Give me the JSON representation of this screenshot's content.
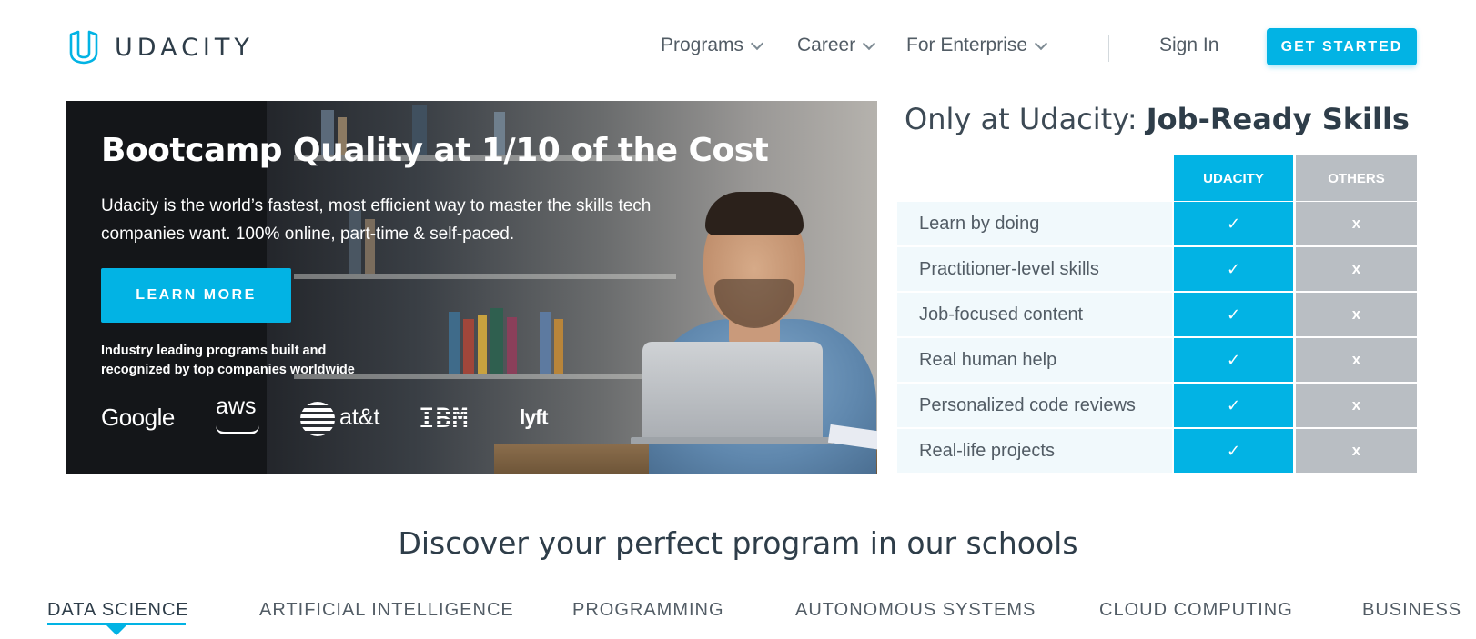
{
  "header": {
    "logo_text": "UDACITY",
    "nav": [
      {
        "label": "Programs",
        "icon": "chevron-down-icon"
      },
      {
        "label": "Career",
        "icon": "chevron-down-icon"
      },
      {
        "label": "For Enterprise",
        "icon": "chevron-down-icon"
      }
    ],
    "sign_in": "Sign In",
    "cta": "GET STARTED"
  },
  "hero": {
    "title": "Bootcamp Quality at 1/10 of the Cost",
    "subtitle": "Udacity is the world’s fastest, most efficient way to master the skills tech companies want. 100% online, part-time & self-paced.",
    "button": "LEARN MORE",
    "industry_text": "Industry leading programs built and recognized by top companies worldwide",
    "partners": [
      "Google",
      "aws",
      "at&t",
      "IBM",
      "lyft"
    ]
  },
  "comparison": {
    "title_light": "Only at Udacity: ",
    "title_bold": "Job-Ready Skills",
    "col_udacity": "UDACITY",
    "col_others": "OTHERS",
    "check_glyph": "✓",
    "x_glyph": "x",
    "rows": [
      {
        "label": "Learn by doing"
      },
      {
        "label": "Practitioner-level skills"
      },
      {
        "label": "Job-focused content"
      },
      {
        "label": "Real human help"
      },
      {
        "label": "Personalized code reviews"
      },
      {
        "label": "Real-life projects"
      }
    ]
  },
  "schools": {
    "title": "Discover your perfect program in our schools",
    "tabs": [
      {
        "label": "DATA SCIENCE",
        "active": true
      },
      {
        "label": "ARTIFICIAL INTELLIGENCE",
        "active": false
      },
      {
        "label": "PROGRAMMING",
        "active": false
      },
      {
        "label": "AUTONOMOUS SYSTEMS",
        "active": false
      },
      {
        "label": "CLOUD COMPUTING",
        "active": false
      },
      {
        "label": "BUSINESS",
        "active": false
      }
    ]
  },
  "colors": {
    "accent": "#02b3e4",
    "text_dark": "#2e3d49",
    "others_gray": "#b9bec3",
    "row_bg": "#f1f9fc"
  }
}
